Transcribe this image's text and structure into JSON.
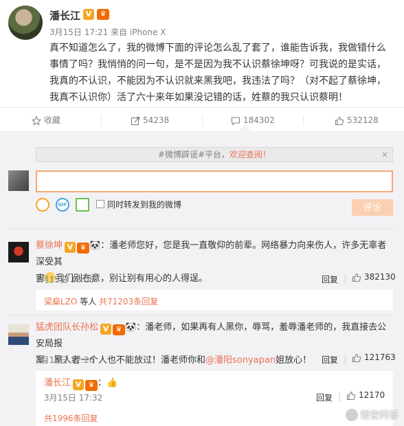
{
  "post": {
    "username": "潘长江",
    "time": "3月15日 17:21",
    "source_prefix": "来自",
    "source": "iPhone X",
    "text": "真不知道怎么了，我的微博下面的评论怎么乱了套了，谁能告诉我，我做错什么事情了吗？我悄悄的问一句，是不是因为我不认识蔡徐坤呀？可我说的是实话，我真的不认识，不能因为不认识就来黑我吧，我违法了吗？（对不起了蔡徐坤，我真不认识你）活了六十来年如果没记错的话，姓蔡的我只认识蔡明！"
  },
  "actions": {
    "favorite": "收藏",
    "repost_count": "54238",
    "comment_count": "184302",
    "like_count": "532128"
  },
  "notice": {
    "prefix": "#微博辟谣#平台，",
    "highlight": "欢迎查阅！",
    "close": "×"
  },
  "compose": {
    "placeholder": "",
    "repost_label": "同时转发到我的微博",
    "submit_label": "评论"
  },
  "comments": [
    {
      "name": "蔡徐坤",
      "text_line1": "：潘老师您好，您是我一直敬仰的前辈。网络暴力向来伤人，许多无辜者深受其",
      "text_line2a": "害",
      "text_line2b": "我们别在意，别让别有用心的人得逞。",
      "time": "3月15日 18:08",
      "reply": "回复",
      "likes": "382130",
      "summary_user": "梁燊LZO",
      "summary_mid": "等人",
      "summary_count": "共71203条回复"
    },
    {
      "name": "猛虎团队长孙松",
      "text_line1": "：潘老师，如果再有人黑你，辱骂，羞辱潘老师的，我直接去公安局报",
      "text_line2a": "案。黑人者一个人也不能放过！潘老师你和",
      "mention": "@潘阳sonyapan",
      "text_line2b": "姐放心！",
      "time": "3月15日 17:26",
      "reply": "回复",
      "likes": "121763"
    }
  ],
  "sub_reply": {
    "name": "潘长江",
    "time": "3月15日 17:32",
    "reply": "回复",
    "likes": "12170",
    "summary_count": "共1996条回复"
  },
  "watermark": "悟空问答",
  "colors": {
    "accent": "#eb7350",
    "badge_v": "#f4a623",
    "badge_level": "#f56a00"
  }
}
